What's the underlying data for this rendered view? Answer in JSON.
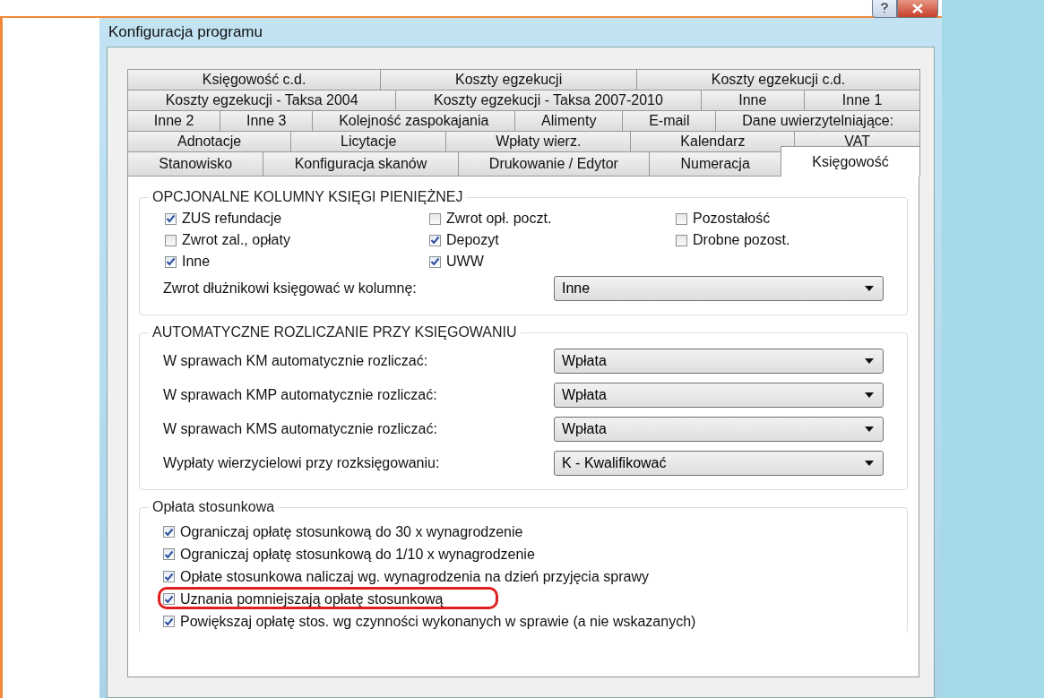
{
  "window": {
    "title": "Konfiguracja programu"
  },
  "tab_rows": [
    [
      {
        "label": "Księgowość c.d.",
        "selected": false
      },
      {
        "label": "Koszty egzekucji",
        "selected": false
      },
      {
        "label": "Koszty egzekucji c.d.",
        "selected": false
      }
    ],
    [
      {
        "label": "Koszty egzekucji - Taksa 2004",
        "selected": false
      },
      {
        "label": "Koszty egzekucji - Taksa 2007-2010",
        "selected": false
      },
      {
        "label": "Inne",
        "selected": false
      },
      {
        "label": "Inne 1",
        "selected": false
      }
    ],
    [
      {
        "label": "Inne 2",
        "selected": false
      },
      {
        "label": "Inne 3",
        "selected": false
      },
      {
        "label": "Kolejność zaspokajania",
        "selected": false
      },
      {
        "label": "Alimenty",
        "selected": false
      },
      {
        "label": "E-mail",
        "selected": false
      },
      {
        "label": "Dane uwierzytelniające:",
        "selected": false
      }
    ],
    [
      {
        "label": "Adnotacje",
        "selected": false
      },
      {
        "label": "Licytacje",
        "selected": false
      },
      {
        "label": "Wpłaty wierz.",
        "selected": false
      },
      {
        "label": "Kalendarz",
        "selected": false
      },
      {
        "label": "VAT",
        "selected": false
      }
    ],
    [
      {
        "label": "Stanowisko",
        "selected": false
      },
      {
        "label": "Konfiguracja skanów",
        "selected": false
      },
      {
        "label": "Drukowanie / Edytor",
        "selected": false
      },
      {
        "label": "Numeracja",
        "selected": false
      },
      {
        "label": "Księgowość",
        "selected": true
      }
    ]
  ],
  "columns_group": {
    "title": "OPCJONALNE KOLUMNY KSIĘGI PIENIĘŻNEJ",
    "checkboxes": [
      {
        "label": "ZUS refundacje",
        "checked": true
      },
      {
        "label": "Zwrot opł. poczt.",
        "checked": false
      },
      {
        "label": "Pozostałość",
        "checked": false
      },
      {
        "label": "Zwrot zal., opłaty",
        "checked": false
      },
      {
        "label": "Depozyt",
        "checked": true
      },
      {
        "label": "Drobne pozost.",
        "checked": false
      },
      {
        "label": "Inne",
        "checked": true
      },
      {
        "label": "UWW",
        "checked": true
      }
    ],
    "dropdowns": [
      {
        "label": "Zwrot dłużnikowi księgować w kolumnę:",
        "value": "Inne"
      }
    ]
  },
  "auto_group": {
    "title": "AUTOMATYCZNE ROZLICZANIE PRZY KSIĘGOWANIU",
    "dropdowns": [
      {
        "label": "W sprawach KM automatycznie rozliczać:",
        "value": "Wpłata"
      },
      {
        "label": "W sprawach KMP automatycznie rozliczać:",
        "value": "Wpłata"
      },
      {
        "label": "W sprawach KMS automatycznie rozliczać:",
        "value": "Wpłata"
      },
      {
        "label": "Wypłaty wierzycielowi przy rozksięgowaniu:",
        "value": "K - Kwalifikować"
      }
    ]
  },
  "fee_group": {
    "title": "Opłata stosunkowa",
    "checkboxes": [
      {
        "label": "Ograniczaj opłatę stosunkową do 30 x wynagrodzenie",
        "checked": true,
        "highlighted": false
      },
      {
        "label": "Ograniczaj opłatę stosunkową do 1/10 x wynagrodzenie",
        "checked": true,
        "highlighted": false
      },
      {
        "label": "Opłate stosunkowa naliczaj wg. wynagrodzenia na dzień przyjęcia sprawy",
        "checked": true,
        "highlighted": false
      },
      {
        "label": "Uznania pomniejszają opłatę stosunkową",
        "checked": true,
        "highlighted": true
      },
      {
        "label": "Powiększaj opłatę stos. wg czynności wykonanych w sprawie (a nie wskazanych)",
        "checked": true,
        "highlighted": false
      }
    ]
  }
}
